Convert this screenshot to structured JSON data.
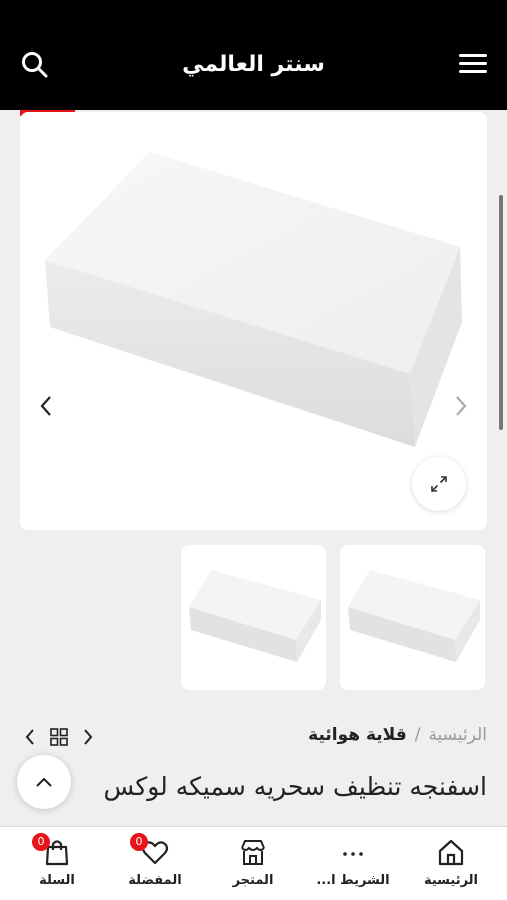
{
  "header": {
    "title": "سنتر العالمي",
    "menu_icon": "hamburger-icon",
    "search_icon": "search-icon"
  },
  "gallery": {
    "image_desc": "white rectangular sponge",
    "prev_icon": "chevron-left-icon",
    "next_icon": "chevron-right-icon",
    "zoom_icon": "expand-icon",
    "thumbnail_count": 2
  },
  "breadcrumb": {
    "home": "الرئيسية",
    "separator": "/",
    "category": "قلاية هوائية"
  },
  "product": {
    "title": "اسفنجه تنظيف سحريه سميكه لوكس"
  },
  "bottom_nav": {
    "items": [
      {
        "label": "الرئيسية",
        "icon": "home-icon"
      },
      {
        "label": "الشريط ا...",
        "icon": "more-icon"
      },
      {
        "label": "المتجر",
        "icon": "store-icon"
      },
      {
        "label": "المفضلة",
        "icon": "heart-icon",
        "badge": "0"
      },
      {
        "label": "السلة",
        "icon": "cart-icon",
        "badge": "0"
      }
    ]
  },
  "colors": {
    "header_bg": "#000000",
    "accent": "#e8141c",
    "page_bg": "#efefef"
  }
}
